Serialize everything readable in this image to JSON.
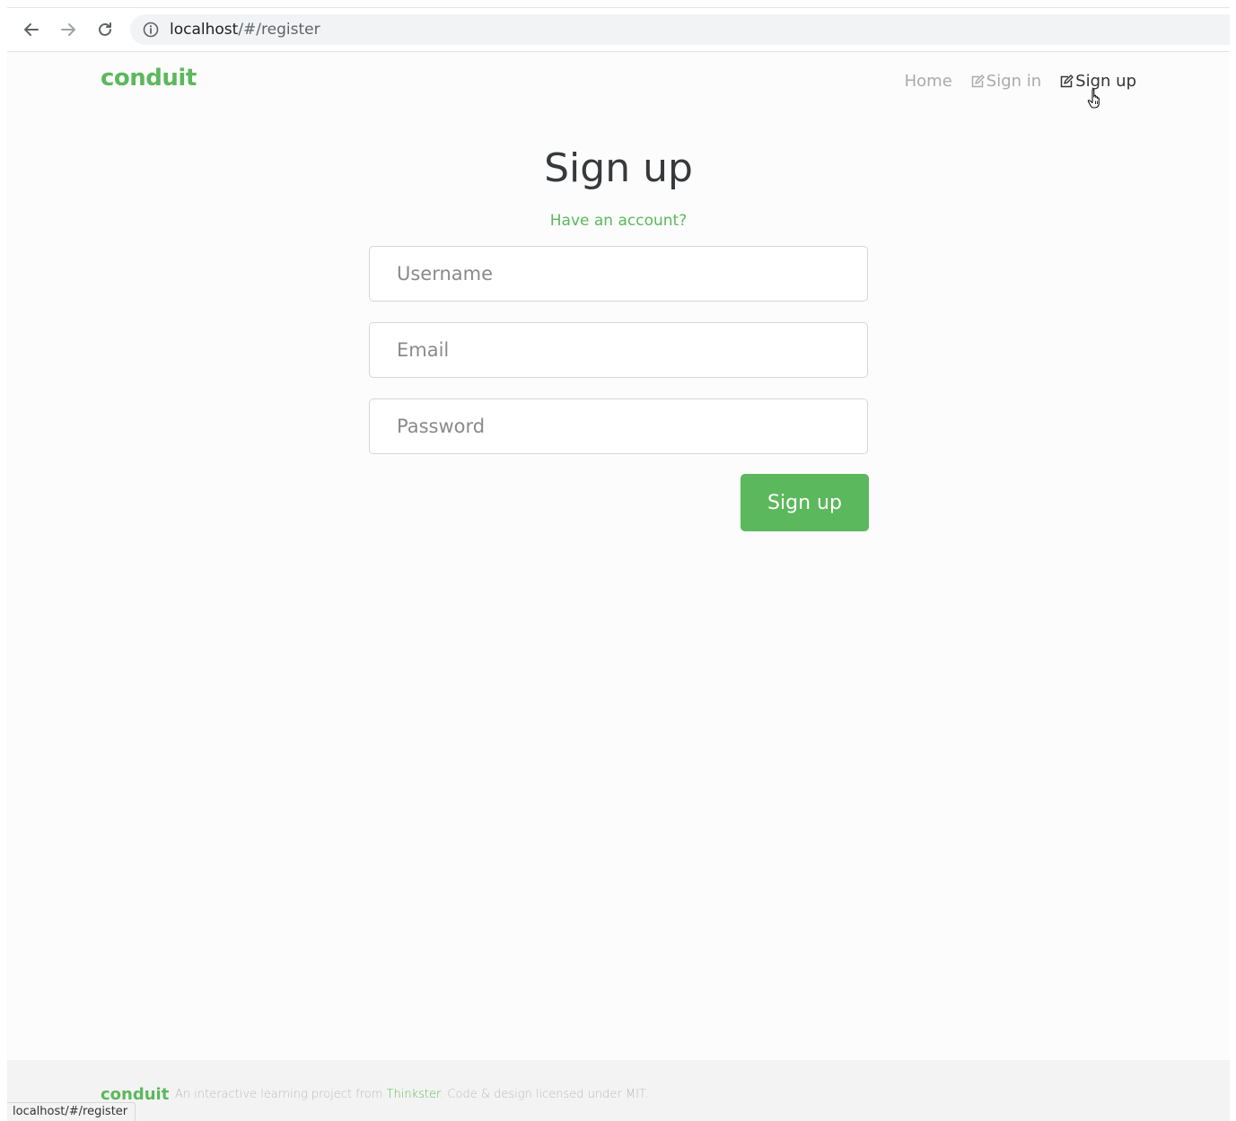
{
  "browser": {
    "url_host": "localhost",
    "url_path": "/#/register",
    "status_url": "localhost/#/register"
  },
  "navbar": {
    "brand": "conduit",
    "links": [
      {
        "label": "Home"
      },
      {
        "label": "Sign in"
      },
      {
        "label": "Sign up"
      }
    ]
  },
  "auth": {
    "title": "Sign up",
    "have_account": "Have an account?",
    "username_placeholder": "Username",
    "email_placeholder": "Email",
    "password_placeholder": "Password",
    "submit_label": "Sign up"
  },
  "footer": {
    "logo": "conduit",
    "text_before": "An interactive learning project from ",
    "link": "Thinkster",
    "text_after": ". Code & design licensed under MIT."
  },
  "colors": {
    "brand_green": "#5cb85c"
  }
}
